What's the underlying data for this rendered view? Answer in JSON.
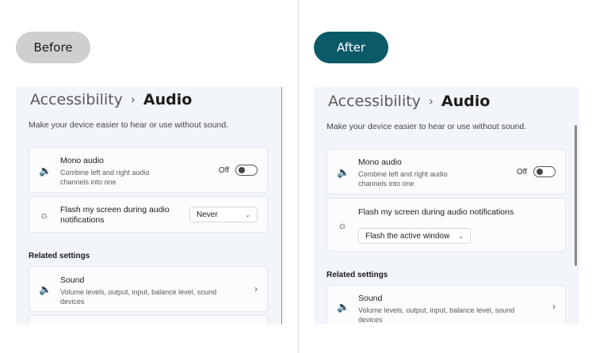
{
  "labels": {
    "before": "Before",
    "after": "After"
  },
  "before": {
    "breadcrumb": {
      "parent": "Accessibility",
      "separator": "›",
      "current": "Audio"
    },
    "subtitle": "Make your device easier to hear or use without sound.",
    "mono": {
      "title": "Mono audio",
      "desc1": "Combine left and right audio",
      "desc2": "channels into one",
      "toggle_label": "Off",
      "icon": "speaker-icon"
    },
    "flash": {
      "title1": "Flash my screen during audio",
      "title2": "notifications",
      "value": "Never",
      "icon": "sun-icon"
    },
    "related": "Related settings",
    "sound": {
      "title": "Sound",
      "desc1": "Volume levels, output, input, balance level, sound",
      "desc2": "devices",
      "icon": "speaker-icon"
    }
  },
  "after": {
    "breadcrumb": {
      "parent": "Accessibility",
      "separator": "›",
      "current": "Audio"
    },
    "subtitle": "Make your device easier to hear or use without sound.",
    "mono": {
      "title": "Mono audio",
      "desc1": "Combine left and right audio",
      "desc2": "channels into one",
      "toggle_label": "Off",
      "icon": "speaker-icon"
    },
    "flash": {
      "title": "Flash my screen during audio notifications",
      "value": "Flash the active window",
      "icon": "sun-icon"
    },
    "related": "Related settings",
    "sound": {
      "title": "Sound",
      "desc1": "Volume levels, output, input, balance level, sound",
      "desc2": "devices",
      "icon": "speaker-icon"
    }
  }
}
